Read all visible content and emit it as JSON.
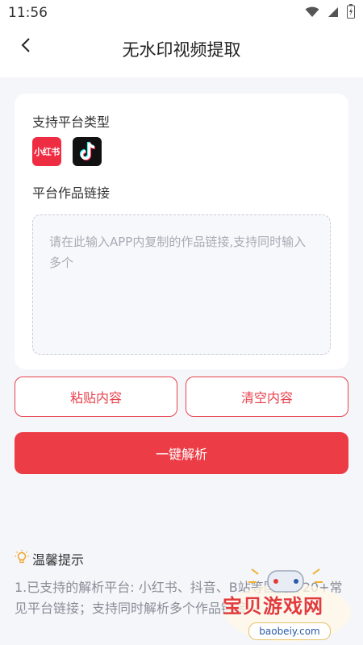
{
  "status_bar": {
    "time": "11:56",
    "icons": [
      "wifi-icon",
      "signal-icon",
      "battery-icon"
    ]
  },
  "app_bar": {
    "title": "无水印视频提取",
    "back_icon": "chevron-left-icon"
  },
  "card": {
    "platforms_label": "支持平台类型",
    "platforms": [
      {
        "name": "xiaohongshu-icon",
        "text": "小红书",
        "color": "#ef2d42"
      },
      {
        "name": "douyin-icon",
        "color": "#111111"
      }
    ],
    "link_label": "平台作品链接",
    "link_input": {
      "value": "",
      "placeholder": "请在此输入APP内复制的作品链接,支持同时输入多个"
    }
  },
  "buttons": {
    "paste_label": "粘贴内容",
    "clear_label": "清空内容",
    "parse_label": "一键解析"
  },
  "tips": {
    "icon": "lightbulb-icon",
    "title": "温馨提示",
    "text": "1.已支持的解析平台: 小红书、抖音、B站等国内外20+常见平台链接；支持同时解析多个作品链接~"
  },
  "watermark": {
    "text": "宝贝游戏网",
    "url": "baobeiy.com"
  },
  "colors": {
    "accent": "#ec3d47",
    "background": "#f5f6fa"
  }
}
